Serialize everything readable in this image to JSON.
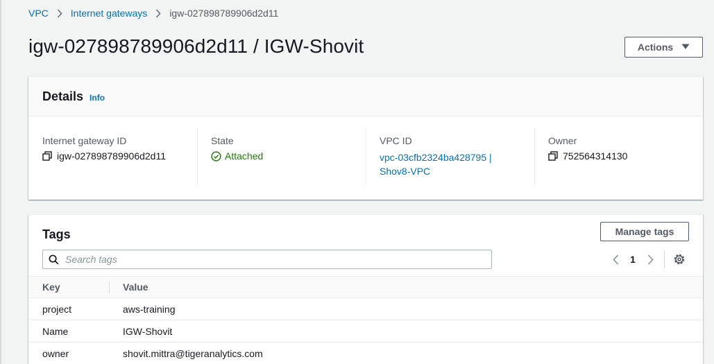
{
  "breadcrumb": {
    "items": [
      "VPC",
      "Internet gateways"
    ],
    "current": "igw-027898789906d2d11"
  },
  "page": {
    "title": "igw-027898789906d2d11 / IGW-Shovit",
    "actions_label": "Actions"
  },
  "details": {
    "title": "Details",
    "info_label": "Info",
    "gateway_id_label": "Internet gateway ID",
    "gateway_id_value": "igw-027898789906d2d11",
    "state_label": "State",
    "state_value": "Attached",
    "vpc_id_label": "VPC ID",
    "vpc_id_line1": "vpc-03cfb2324ba428795 |",
    "vpc_id_line2": "Shov8-VPC",
    "owner_label": "Owner",
    "owner_value": "752564314130"
  },
  "tags": {
    "title": "Tags",
    "manage_label": "Manage tags",
    "search_placeholder": "Search tags",
    "current_page": "1",
    "columns": {
      "key": "Key",
      "value": "Value"
    },
    "rows": [
      {
        "key": "project",
        "value": "aws-training"
      },
      {
        "key": "Name",
        "value": "IGW-Shovit"
      },
      {
        "key": "owner",
        "value": "shovit.mittra@tigeranalytics.com"
      }
    ]
  },
  "icons": {
    "breadcrumb_separator": "chevron-right-icon",
    "actions_caret": "caret-down-icon",
    "copy": "copy-icon",
    "state_ok": "status-success-icon",
    "search": "search-icon",
    "pager_prev": "chevron-left-icon",
    "pager_next": "chevron-right-icon",
    "settings": "gear-icon"
  },
  "colors": {
    "link": "#0073bb",
    "success": "#1d8102",
    "background": "#f2f3f3",
    "text_secondary": "#545b64"
  }
}
